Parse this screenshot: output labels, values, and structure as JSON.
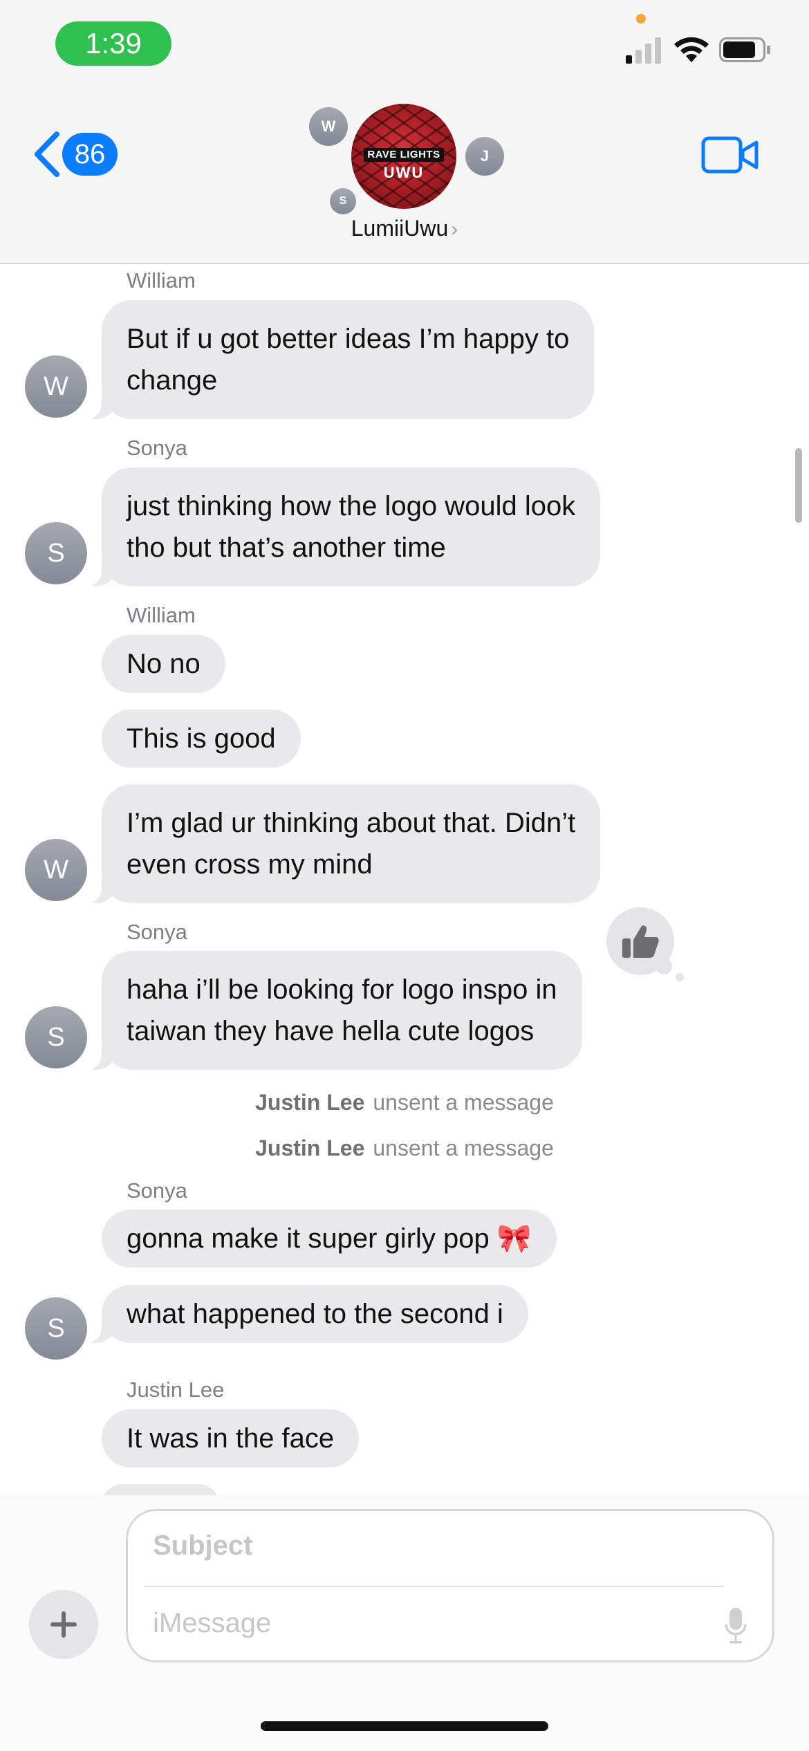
{
  "status_bar": {
    "time": "1:39"
  },
  "header": {
    "back_count": "86",
    "group_name": "LumiiUwu",
    "group_name_chevron": "›",
    "avatar_line1": "RAVE LIGHTS",
    "avatar_line2": "UWU",
    "participants": {
      "w": "W",
      "j": "J",
      "s": "S"
    }
  },
  "messages": {
    "m1": {
      "sender": "William",
      "text_line1": "But if u got better ideas I’m happy to",
      "text_line2": "change",
      "avatar": "W"
    },
    "m2": {
      "sender": "Sonya",
      "text_line1": "just thinking how the logo would look",
      "text_line2": "tho but that’s another time",
      "avatar": "S"
    },
    "m3": {
      "sender": "William",
      "text": "No no"
    },
    "m4": {
      "text": "This is good"
    },
    "m5": {
      "text_line1": "I’m glad ur thinking about that. Didn’t",
      "text_line2": "even cross my mind",
      "avatar": "W"
    },
    "m6": {
      "sender": "Sonya",
      "text_line1": "haha i’ll be looking for logo inspo in",
      "text_line2": "taiwan they have hella cute logos",
      "avatar": "S",
      "reaction": "thumbs-up-icon"
    },
    "sys1": {
      "name": "Justin Lee",
      "action": "unsent a message"
    },
    "sys2": {
      "name": "Justin Lee",
      "action": "unsent a message"
    },
    "m7": {
      "sender": "Sonya",
      "text": "gonna make it super girly pop 🎀"
    },
    "m8": {
      "text": "what happened to the second i",
      "avatar": "S"
    },
    "m9": {
      "sender": "Justin Lee",
      "text": "It was in the face"
    }
  },
  "composer": {
    "subject_placeholder": "Subject",
    "message_placeholder": "iMessage",
    "plus": "+"
  },
  "colors": {
    "accent": "#0a7cff",
    "bubble_incoming": "#e9e9eb",
    "time_pill": "#30c04f"
  }
}
